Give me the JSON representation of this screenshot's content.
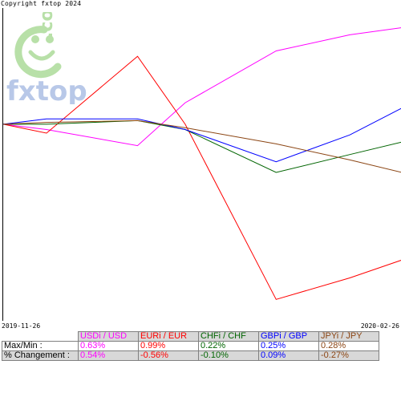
{
  "copyright": "Copyright fxtop 2024",
  "watermark": {
    "text": "fxtop",
    "suffix": ".com",
    "color": "#b8e0a8",
    "text_color": "#b8c8e8",
    "icon": "smiley-logo"
  },
  "chart_data": {
    "type": "line",
    "title": "",
    "xlabel": "",
    "ylabel": "",
    "x": [
      "2019-11-26",
      "2019-12-06",
      "2019-12-27",
      "2020-01-07",
      "2020-01-28",
      "2020-02-14",
      "2020-02-26"
    ],
    "x_tick_labels": [
      "2019-11-26",
      "2020-02-26"
    ],
    "ylim": [
      -1.1,
      0.65
    ],
    "grid": false,
    "series": [
      {
        "name": "USDi / USD",
        "color": "#ff00ff",
        "values": [
          0.0,
          -0.03,
          -0.12,
          0.12,
          0.41,
          0.5,
          0.54
        ]
      },
      {
        "name": "EURi / EUR",
        "color": "#ff0000",
        "values": [
          0.0,
          -0.05,
          0.38,
          0.0,
          -0.98,
          -0.86,
          -0.76
        ]
      },
      {
        "name": "CHFi / CHF",
        "color": "#006400",
        "values": [
          0.0,
          0.0,
          0.02,
          -0.03,
          -0.27,
          -0.17,
          -0.1
        ]
      },
      {
        "name": "GBPi / GBP",
        "color": "#0000ff",
        "values": [
          0.0,
          0.03,
          0.03,
          -0.03,
          -0.21,
          -0.06,
          0.09
        ]
      },
      {
        "name": "JPYi / JPY",
        "color": "#8b4513",
        "values": [
          0.0,
          0.01,
          0.02,
          -0.02,
          -0.11,
          -0.2,
          -0.27
        ]
      }
    ]
  },
  "stats": {
    "row1_label": "Max/Min :",
    "row2_label": "% Changement :",
    "columns": [
      {
        "name": "USDi / USD",
        "color": "#ff00ff",
        "maxmin": "0.63%",
        "change": "0.54%"
      },
      {
        "name": "EURi / EUR",
        "color": "#ff0000",
        "maxmin": "0.99%",
        "change": "-0.56%"
      },
      {
        "name": "CHFi / CHF",
        "color": "#006400",
        "maxmin": "0.22%",
        "change": "-0.10%"
      },
      {
        "name": "GBPi / GBP",
        "color": "#0000ff",
        "maxmin": "0.25%",
        "change": "0.09%"
      },
      {
        "name": "JPYi / JPY",
        "color": "#8b4513",
        "maxmin": "0.28%",
        "change": "-0.27%"
      }
    ]
  }
}
